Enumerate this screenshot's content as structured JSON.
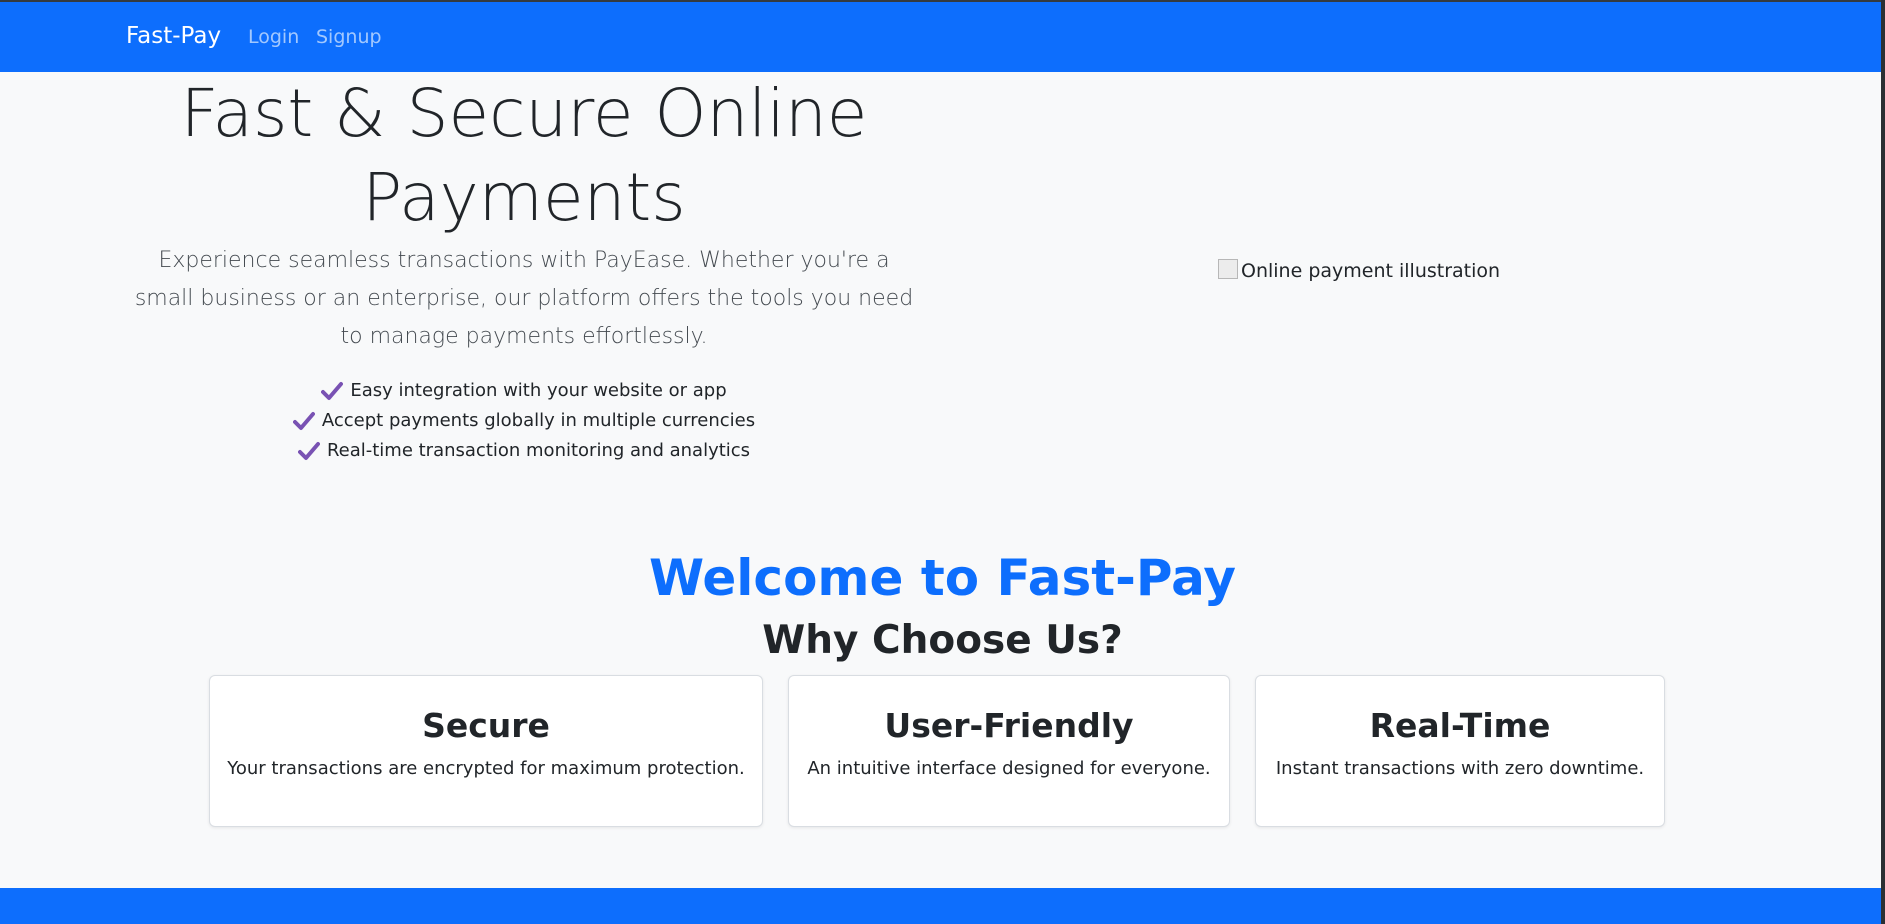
{
  "navbar": {
    "brand": "Fast-Pay",
    "links": [
      {
        "label": "Login"
      },
      {
        "label": "Signup"
      }
    ]
  },
  "hero": {
    "title": "Fast & Secure Online Payments",
    "lead": "Experience seamless transactions with PayEase. Whether you're a small business or an enterprise, our platform offers the tools you need to manage payments effortlessly.",
    "features": [
      "Easy integration with your website or app",
      "Accept payments globally in multiple currencies",
      "Real-time transaction monitoring and analytics"
    ],
    "check_icon": "check-icon",
    "check_color": "#7952b3",
    "image_alt": "Online payment illustration"
  },
  "welcome": {
    "heading": "Welcome to Fast-Pay",
    "subheading": "Why Choose Us?"
  },
  "cards": [
    {
      "title": "Secure",
      "text": "Your transactions are encrypted for maximum protection."
    },
    {
      "title": "User-Friendly",
      "text": "An intuitive interface designed for everyone."
    },
    {
      "title": "Real-Time",
      "text": "Instant transactions with zero downtime."
    }
  ],
  "colors": {
    "primary": "#0d6efd",
    "background": "#f8f9fa",
    "text": "#212529"
  }
}
